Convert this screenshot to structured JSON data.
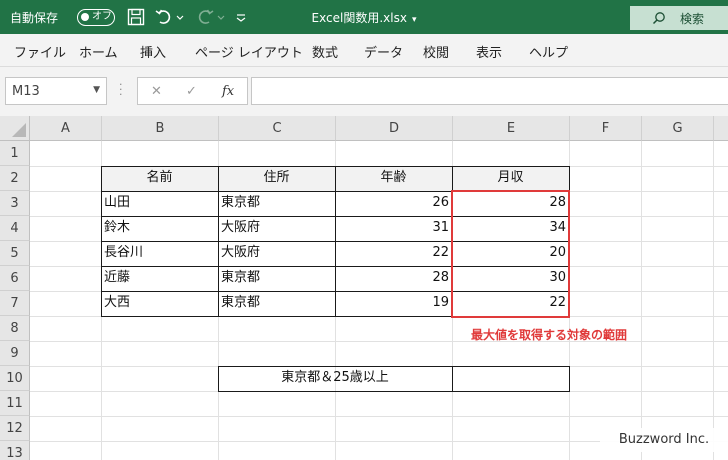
{
  "titlebar": {
    "autosave_label": "自動保存",
    "autosave_state": "オフ",
    "doc_title": "Excel関数用.xlsx",
    "search_label": "検索",
    "accent": "#217346"
  },
  "ribbon": {
    "tabs": [
      "ファイル",
      "ホーム",
      "挿入",
      "ページ レイアウト",
      "数式",
      "データ",
      "校閲",
      "表示",
      "ヘルプ"
    ]
  },
  "formula_bar": {
    "name_box": "M13",
    "fx_label": "fx",
    "formula": ""
  },
  "sheet": {
    "columns": [
      "A",
      "B",
      "C",
      "D",
      "E",
      "F",
      "G"
    ],
    "rows": [
      "1",
      "2",
      "3",
      "4",
      "5",
      "6",
      "7",
      "8",
      "9",
      "10",
      "11",
      "12",
      "13"
    ],
    "table": {
      "headers": [
        "名前",
        "住所",
        "年齢",
        "月収"
      ],
      "rows": [
        [
          "山田",
          "東京都",
          "26",
          "28"
        ],
        [
          "鈴木",
          "大阪府",
          "31",
          "34"
        ],
        [
          "長谷川",
          "大阪府",
          "22",
          "20"
        ],
        [
          "近藤",
          "東京都",
          "28",
          "30"
        ],
        [
          "大西",
          "東京都",
          "19",
          "22"
        ]
      ]
    },
    "annotation": "最大値を取得する対象の範囲",
    "criteria_label": "東京都＆25歳以上",
    "criteria_value": "",
    "highlight_color": "#e03a3a"
  },
  "watermark": "Buzzword Inc."
}
